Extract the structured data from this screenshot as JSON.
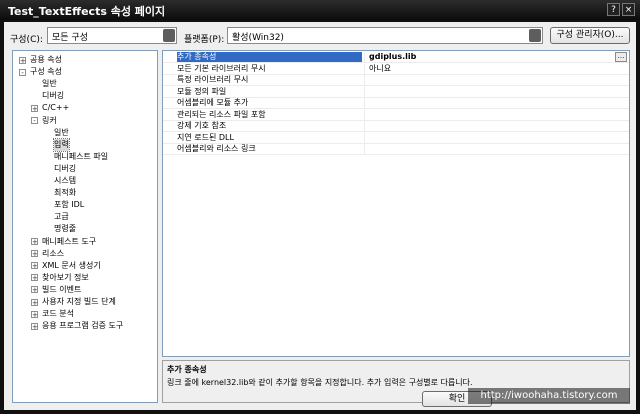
{
  "window": {
    "title": "Test_TextEffects 속성 페이지",
    "controls": [
      "?",
      "×"
    ]
  },
  "toolbar": {
    "config_label": "구성(C):",
    "config_value": "모든 구성",
    "platform_label": "플랫폼(P):",
    "platform_value": "활성(Win32)",
    "config_manager_label": "구성 관리자(O)..."
  },
  "tree": {
    "nodes": [
      {
        "label": "공용 속성",
        "expander": "+",
        "selected": false
      },
      {
        "label": "구성 속성",
        "expander": "-",
        "selected": false
      },
      {
        "label": "일반",
        "expander": "",
        "selected": false
      },
      {
        "label": "디버깅",
        "expander": "",
        "selected": false
      },
      {
        "label": "C/C++",
        "expander": "+",
        "selected": false
      },
      {
        "label": "링커",
        "expander": "-",
        "selected": false
      },
      {
        "label": "일반",
        "expander": "",
        "selected": false
      },
      {
        "label": "입력",
        "expander": "",
        "selected": true
      },
      {
        "label": "매니페스트 파일",
        "expander": "",
        "selected": false
      },
      {
        "label": "디버깅",
        "expander": "",
        "selected": false
      },
      {
        "label": "시스템",
        "expander": "",
        "selected": false
      },
      {
        "label": "최적화",
        "expander": "",
        "selected": false
      },
      {
        "label": "포함 IDL",
        "expander": "",
        "selected": false
      },
      {
        "label": "고급",
        "expander": "",
        "selected": false
      },
      {
        "label": "명령줄",
        "expander": "",
        "selected": false
      },
      {
        "label": "매니페스트 도구",
        "expander": "+",
        "selected": false
      },
      {
        "label": "리소스",
        "expander": "+",
        "selected": false
      },
      {
        "label": "XML 문서 생성기",
        "expander": "+",
        "selected": false
      },
      {
        "label": "찾아보기 정보",
        "expander": "+",
        "selected": false
      },
      {
        "label": "빌드 이벤트",
        "expander": "+",
        "selected": false
      },
      {
        "label": "사용자 지정 빌드 단계",
        "expander": "+",
        "selected": false
      },
      {
        "label": "코드 분석",
        "expander": "+",
        "selected": false
      },
      {
        "label": "응용 프로그램 검증 도구",
        "expander": "+",
        "selected": false
      }
    ]
  },
  "grid": {
    "rows": [
      {
        "name": "추가 종속성",
        "value": "gdiplus.lib",
        "selected": true,
        "bold": true
      },
      {
        "name": "모든 기본 라이브러리 무시",
        "value": "아니요",
        "selected": false,
        "bold": false
      },
      {
        "name": "특정 라이브러리 무시",
        "value": "",
        "selected": false,
        "bold": false
      },
      {
        "name": "모듈 정의 파일",
        "value": "",
        "selected": false,
        "bold": false
      },
      {
        "name": "어셈블리에 모듈 추가",
        "value": "",
        "selected": false,
        "bold": false
      },
      {
        "name": "관리되는 리소스 파일 포함",
        "value": "",
        "selected": false,
        "bold": false
      },
      {
        "name": "강제 기호 참조",
        "value": "",
        "selected": false,
        "bold": false
      },
      {
        "name": "지연 로드된 DLL",
        "value": "",
        "selected": false,
        "bold": false
      },
      {
        "name": "어셈블리와 리소스 링크",
        "value": "",
        "selected": false,
        "bold": false
      }
    ],
    "ellipsis": "..."
  },
  "description": {
    "title": "추가 종속성",
    "text": "링크 줄에 kernel32.lib와 같이 추가할 항목을 지정합니다. 추가 입력은 구성별로 다릅니다."
  },
  "footer": {
    "ok_label": "확인",
    "watermark": "http://iwoohaha.tistory.com"
  }
}
